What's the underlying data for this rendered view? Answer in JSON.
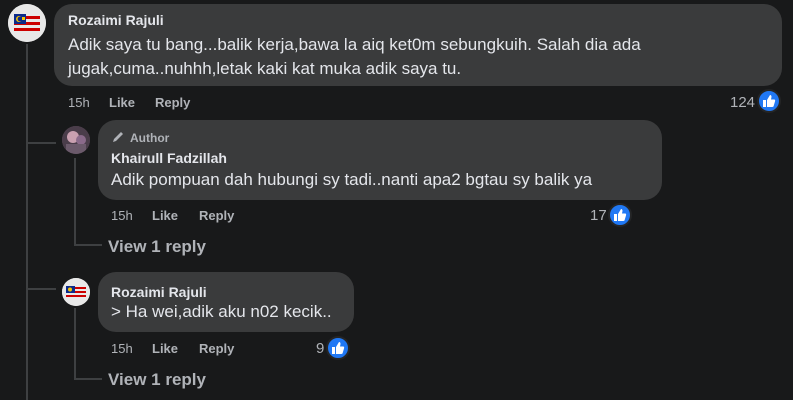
{
  "comments": [
    {
      "author": "Rozaimi Rajuli",
      "text_line1": "Adik saya tu bang...balik kerja,bawa la aiq ket0m sebungkuih. Salah dia ada",
      "text_line2": "jugak,cuma..nuhhh,letak kaki kat muka adik saya tu.",
      "time": "15h",
      "like_label": "Like",
      "reply_label": "Reply",
      "reaction_count": "124"
    },
    {
      "badge": "Author",
      "author": "Khairull Fadzillah",
      "text": "Adik pompuan dah hubungi sy tadi..nanti apa2 bgtau sy balik ya",
      "time": "15h",
      "like_label": "Like",
      "reply_label": "Reply",
      "reaction_count": "17",
      "view_replies": "View 1 reply"
    },
    {
      "author": "Rozaimi Rajuli",
      "text": "> Ha wei,adik aku n02 kecik..",
      "time": "15h",
      "like_label": "Like",
      "reply_label": "Reply",
      "reaction_count": "9",
      "view_replies": "View 1 reply"
    }
  ],
  "colors": {
    "background": "#18191a",
    "bubble": "#3a3b3c",
    "like_blue": "#2078f4",
    "muted_text": "#b0b3b8"
  },
  "icons": [
    "like-thumb-icon",
    "pencil-icon",
    "flag-avatar"
  ]
}
